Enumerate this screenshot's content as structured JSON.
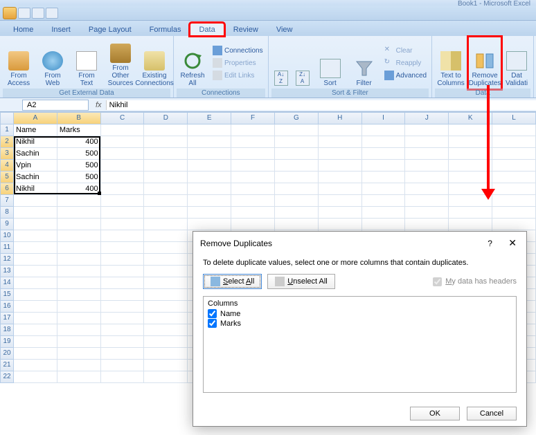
{
  "app": {
    "title": "Book1 - Microsoft Excel"
  },
  "tabs": [
    "Home",
    "Insert",
    "Page Layout",
    "Formulas",
    "Data",
    "Review",
    "View"
  ],
  "active_tab": "Data",
  "ribbon": {
    "ext_data": {
      "label": "Get External Data",
      "from_access": "From\nAccess",
      "from_web": "From\nWeb",
      "from_text": "From\nText",
      "from_other": "From Other\nSources",
      "existing": "Existing\nConnections"
    },
    "connections": {
      "label": "Connections",
      "refresh": "Refresh\nAll",
      "conn": "Connections",
      "prop": "Properties",
      "edit": "Edit Links"
    },
    "sortfilter": {
      "label": "Sort & Filter",
      "sort": "Sort",
      "filter": "Filter",
      "clear": "Clear",
      "reapply": "Reapply",
      "advanced": "Advanced"
    },
    "datatools": {
      "label": "Data",
      "t2c": "Text to\nColumns",
      "remdup": "Remove\nDuplicates",
      "valid": "Dat\nValidati"
    }
  },
  "namebox": "A2",
  "formula": "Nikhil",
  "columns": [
    "A",
    "B",
    "C",
    "D",
    "E",
    "F",
    "G",
    "H",
    "I",
    "J",
    "K",
    "L"
  ],
  "rows_visible": 22,
  "sheet": {
    "headers": [
      "Name",
      "Marks"
    ],
    "data": [
      {
        "name": "Nikhil",
        "marks": 400
      },
      {
        "name": "Sachin",
        "marks": 500
      },
      {
        "name": "Vpin",
        "marks": 500
      },
      {
        "name": "Sachin",
        "marks": 500
      },
      {
        "name": "Nikhil",
        "marks": 400
      }
    ]
  },
  "selection": {
    "ref": "A2:B6"
  },
  "dialog": {
    "title": "Remove Duplicates",
    "help": "?",
    "text": "To delete duplicate values, select one or more columns that contain duplicates.",
    "select_all": "Select All",
    "unselect_all": "Unselect All",
    "headers_chk": "My data has headers",
    "list_header": "Columns",
    "items": [
      "Name",
      "Marks"
    ],
    "ok": "OK",
    "cancel": "Cancel"
  }
}
